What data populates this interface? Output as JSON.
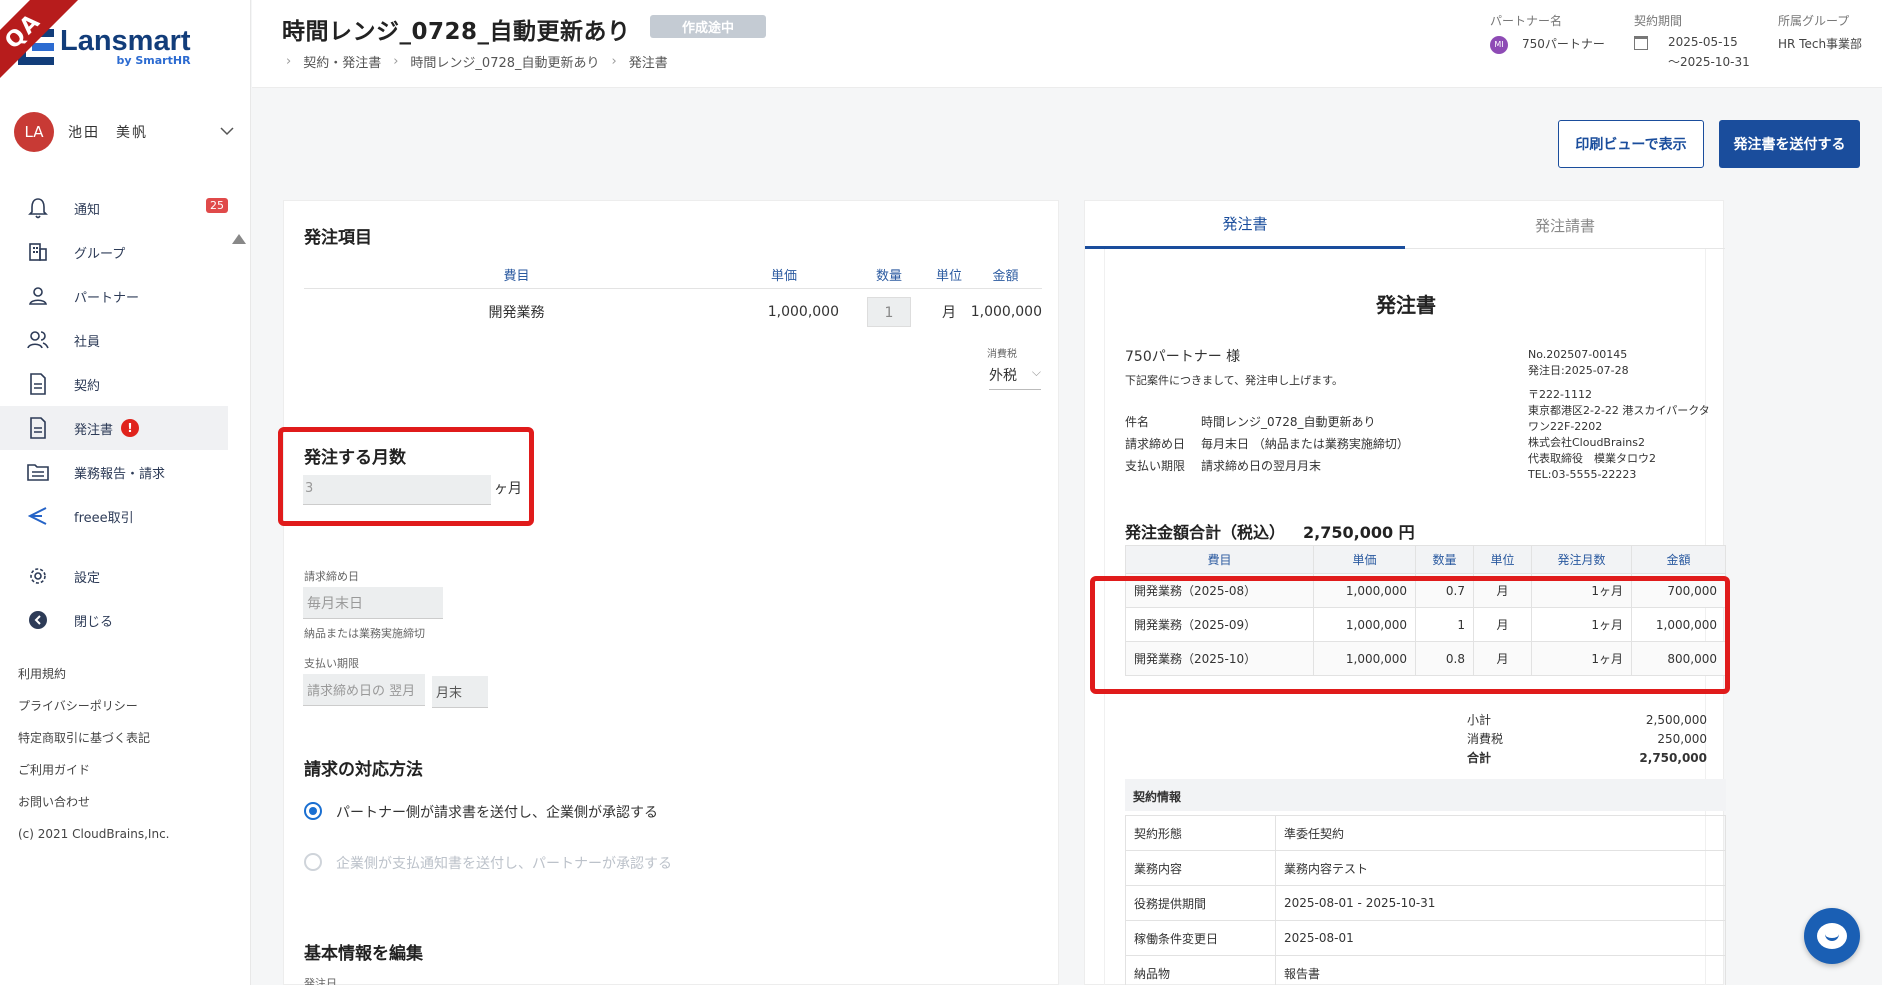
{
  "qa_badge": "QA",
  "brand": {
    "name": "Lansmart",
    "sub": "by SmartHR"
  },
  "user": {
    "initials": "LA",
    "name": "池田　美帆"
  },
  "nav": [
    {
      "label": "通知",
      "icon": "bell-icon",
      "badge": "25"
    },
    {
      "label": "グループ",
      "icon": "building-icon"
    },
    {
      "label": "パートナー",
      "icon": "person-icon"
    },
    {
      "label": "社員",
      "icon": "people-icon"
    },
    {
      "label": "契約",
      "icon": "document-icon"
    },
    {
      "label": "発注書",
      "icon": "document-icon",
      "alert": "!"
    },
    {
      "label": "業務報告・請求",
      "icon": "folder-icon"
    },
    {
      "label": "freee取引",
      "icon": "freee-icon"
    },
    {
      "label": "設定",
      "icon": "gear-icon"
    },
    {
      "label": "閉じる",
      "icon": "arrow-left-circle-icon"
    }
  ],
  "footer": [
    "利用規約",
    "プライバシーポリシー",
    "特定商取引に基づく表記",
    "ご利用ガイド",
    "お問い合わせ",
    "(c) 2021 CloudBrains,Inc."
  ],
  "header": {
    "title": "時間レンジ_0728_自動更新あり",
    "status": "作成途中",
    "breadcrumb": [
      "契約・発注書",
      "時間レンジ_0728_自動更新あり",
      "発注書"
    ],
    "partner_label": "パートナー名",
    "partner_initials": "MI",
    "partner_name": "750パートナー",
    "period_label": "契約期間",
    "period_start": "2025-05-15",
    "period_end": "〜2025-10-31",
    "group_label": "所属グループ",
    "group_name": "HR Tech事業部"
  },
  "actions": {
    "print": "印刷ビューで表示",
    "send": "発注書を送付する"
  },
  "order_items": {
    "title": "発注項目",
    "headers": [
      "費目",
      "単価",
      "数量",
      "単位",
      "金額"
    ],
    "row": {
      "name": "開発業務",
      "price": "1,000,000",
      "qty": "1",
      "unit": "月",
      "amount": "1,000,000"
    },
    "tax_label": "消費税",
    "tax_value": "外税"
  },
  "months": {
    "title": "発注する月数",
    "value": "3",
    "unit": "ヶ月"
  },
  "billing": {
    "close_label": "請求締め日",
    "close_value": "毎月末日",
    "close_note": "納品または業務実施締切",
    "due_label": "支払い期限",
    "due_value1": "請求締め日の 翌月",
    "due_value2": "月末"
  },
  "method": {
    "title": "請求の対応方法",
    "opt1": "パートナー側が請求書を送付し、企業側が承認する",
    "opt2": "企業側が支払通知書を送付し、パートナーが承認する"
  },
  "basic": {
    "title": "基本情報を編集",
    "order_date_label": "発注日"
  },
  "preview": {
    "tabs": [
      "発注書",
      "発注請書"
    ],
    "doc_title": "発注書",
    "to": "750パートナー 様",
    "note": "下記案件につきまして、発注申し上げます。",
    "subject_k": "件名",
    "subject_v": "時間レンジ_0728_自動更新あり",
    "close_k": "請求締め日",
    "close_v": "毎月末日 （納品または業務実施締切）",
    "due_k": "支払い期限",
    "due_v": "請求締め日の翌月月末",
    "no": "No.202507-00145",
    "date": "発注日:2025-07-28",
    "postal": "〒222-1112",
    "address": "東京都港区2-2-22 港スカイパークタワン22F-2202",
    "company": "株式会社CloudBrains2",
    "rep": "代表取締役　模業タロウ2",
    "tel": "TEL:03-5555-22223",
    "total_label": "発注金額合計（税込）",
    "total_value": "2,750,000 円",
    "table_headers": [
      "費目",
      "単価",
      "数量",
      "単位",
      "発注月数",
      "金額"
    ],
    "rows": [
      {
        "name": "開発業務（2025-08）",
        "price": "1,000,000",
        "qty": "0.7",
        "unit": "月",
        "months": "1ヶ月",
        "amount": "700,000"
      },
      {
        "name": "開発業務（2025-09）",
        "price": "1,000,000",
        "qty": "1",
        "unit": "月",
        "months": "1ヶ月",
        "amount": "1,000,000"
      },
      {
        "name": "開発業務（2025-10）",
        "price": "1,000,000",
        "qty": "0.8",
        "unit": "月",
        "months": "1ヶ月",
        "amount": "800,000"
      }
    ],
    "subtotal_k": "小計",
    "subtotal_v": "2,500,000",
    "tax_k": "消費税",
    "tax_v": "250,000",
    "grand_k": "合計",
    "grand_v": "2,750,000",
    "info_title": "契約情報",
    "info": [
      {
        "k": "契約形態",
        "v": "準委任契約"
      },
      {
        "k": "業務内容",
        "v": "業務内容テスト"
      },
      {
        "k": "役務提供期間",
        "v": "2025-08-01 - 2025-10-31"
      },
      {
        "k": "稼働条件変更日",
        "v": "2025-08-01"
      },
      {
        "k": "納品物",
        "v": "報告書"
      }
    ]
  }
}
